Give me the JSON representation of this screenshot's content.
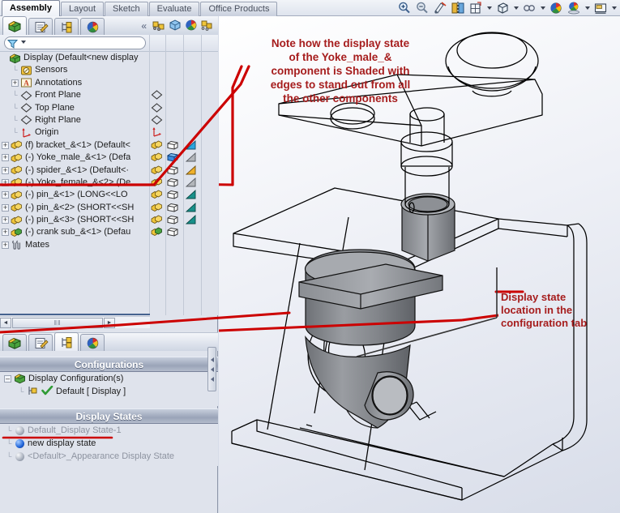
{
  "window": {
    "command_tabs": [
      {
        "label": "Assembly",
        "active": true
      },
      {
        "label": "Layout",
        "active": false
      },
      {
        "label": "Sketch",
        "active": false
      },
      {
        "label": "Evaluate",
        "active": false
      },
      {
        "label": "Office Products",
        "active": false
      }
    ],
    "top_toolbar_icons": [
      "zoom-in-icon",
      "zoom-out-icon",
      "section-view-icon",
      "mirror-icon",
      "view-orientation-icon",
      "display-style-icon",
      "hide-show-icon",
      "appearance-icon",
      "scene-icon",
      "view-settings-icon"
    ]
  },
  "manager_tabs": {
    "items": [
      {
        "name": "feature-manager-tab",
        "icon": "assembly-tree-icon",
        "active": true
      },
      {
        "name": "property-manager-tab",
        "icon": "property-manager-icon",
        "active": false
      },
      {
        "name": "configuration-manager-tab",
        "icon": "configuration-manager-icon",
        "active": false
      },
      {
        "name": "display-manager-tab",
        "icon": "display-manager-icon",
        "active": false
      }
    ],
    "collapse_glyph": "«",
    "tools": [
      "hide-show-components-icon",
      "change-transparency-icon",
      "edit-appearance-icon",
      "assembly-transparency-icon"
    ]
  },
  "filter": {
    "icon": "filter-funnel-icon",
    "placeholder": "",
    "value": ""
  },
  "feature_tree": {
    "rows": [
      {
        "indent": 0,
        "expander": "none",
        "icon": "assembly-icon",
        "label": "Display  (Default<new display",
        "columns": [
          "",
          "",
          ""
        ]
      },
      {
        "indent": 14,
        "expander": "dots",
        "icon": "sensors-icon",
        "label": "Sensors",
        "columns": [
          "",
          "",
          ""
        ]
      },
      {
        "indent": 14,
        "expander": "plus",
        "icon": "annotations-icon",
        "label": "Annotations",
        "columns": [
          "",
          "",
          ""
        ]
      },
      {
        "indent": 14,
        "expander": "dots",
        "icon": "plane-icon",
        "label": "Front Plane",
        "columns": [
          "plane-icon",
          "",
          ""
        ]
      },
      {
        "indent": 14,
        "expander": "dots",
        "icon": "plane-icon",
        "label": "Top Plane",
        "columns": [
          "plane-icon",
          "",
          ""
        ]
      },
      {
        "indent": 14,
        "expander": "dots",
        "icon": "plane-icon",
        "label": "Right Plane",
        "columns": [
          "plane-icon",
          "",
          ""
        ]
      },
      {
        "indent": 14,
        "expander": "dots",
        "icon": "origin-icon",
        "label": "Origin",
        "columns": [
          "origin-icon",
          "",
          ""
        ]
      },
      {
        "indent": 2,
        "expander": "plus",
        "icon": "part-yellow-icon",
        "label": "(f) bracket_&<1>  (Default<",
        "columns": [
          "part-yellow-icon",
          "cube-wireframe-icon",
          "tri-blue-icon"
        ]
      },
      {
        "indent": 2,
        "expander": "plus",
        "icon": "part-yellow-icon",
        "label": "(-) Yoke_male_&<1>  (Defa",
        "columns": [
          "part-yellow-icon",
          "cube-shaded-icon",
          "tri-gray-icon"
        ]
      },
      {
        "indent": 2,
        "expander": "plus",
        "icon": "part-yellow-icon",
        "label": "(-) spider_&<1>  (Default<·",
        "columns": [
          "part-yellow-icon",
          "cube-wireframe-icon",
          "tri-orange-icon"
        ]
      },
      {
        "indent": 2,
        "expander": "plus",
        "icon": "part-yellow-icon",
        "label": "(-) Yoke_female_&<2>  (De",
        "columns": [
          "part-yellow-icon",
          "cube-wireframe-icon",
          "tri-gray-icon"
        ]
      },
      {
        "indent": 2,
        "expander": "plus",
        "icon": "part-yellow-icon",
        "label": "(-) pin_&<1>  (LONG<<LO",
        "columns": [
          "part-yellow-icon",
          "cube-wireframe-icon",
          "tri-teal-icon"
        ]
      },
      {
        "indent": 2,
        "expander": "plus",
        "icon": "part-yellow-icon",
        "label": "(-) pin_&<2>  (SHORT<<SH",
        "columns": [
          "part-yellow-icon",
          "cube-wireframe-icon",
          "tri-teal-icon"
        ]
      },
      {
        "indent": 2,
        "expander": "plus",
        "icon": "part-yellow-icon",
        "label": "(-) pin_&<3>  (SHORT<<SH",
        "columns": [
          "part-yellow-icon",
          "cube-wireframe-icon",
          "tri-teal-icon"
        ]
      },
      {
        "indent": 2,
        "expander": "plus",
        "icon": "subassembly-icon",
        "label": "(-) crank sub_&<1>  (Defau",
        "columns": [
          "subassembly-icon",
          "cube-wireframe-icon",
          ""
        ]
      },
      {
        "indent": 2,
        "expander": "plus",
        "icon": "mates-icon",
        "label": "Mates",
        "columns": [
          "",
          "",
          ""
        ]
      }
    ]
  },
  "tree_scrollbar": {
    "left_arrow": "◄",
    "right_arrow": "►",
    "thumb_grip": "‖‖"
  },
  "configurations": {
    "header": "Configurations",
    "rows": [
      {
        "expander": "minus",
        "icon": "assembly-icon",
        "label": "Display Configuration(s)",
        "indent": 4,
        "dim": false
      },
      {
        "expander": "none",
        "icon": "config-check-icon",
        "label": "Default [ Display ]",
        "indent": 22,
        "dim": false
      }
    ]
  },
  "display_states": {
    "header": "Display States",
    "rows": [
      {
        "icon": "display-state-off-icon",
        "label": "Default_Display State-1",
        "dim": true,
        "selected": false
      },
      {
        "icon": "display-state-on-icon",
        "label": "new display state",
        "dim": false,
        "selected": true
      },
      {
        "icon": "display-state-off-icon",
        "label": "<Default>_Appearance Display State",
        "dim": true,
        "selected": false
      }
    ]
  },
  "annotations": {
    "note1": "Note how the display state\nof the Yoke_male_&\ncomponent is Shaded with\nedges to stand out from all\nthe other components",
    "note2": "Display state\nlocation in the\nconfiguration tab",
    "color": "#a61d1d",
    "leader_color": "#cc0000"
  },
  "graphics": {
    "model_name": "universal-joint-assembly",
    "shaded_part": "Yoke_male_&<1>",
    "background_top": "#ffffff",
    "background_bottom": "#d8dde9"
  }
}
